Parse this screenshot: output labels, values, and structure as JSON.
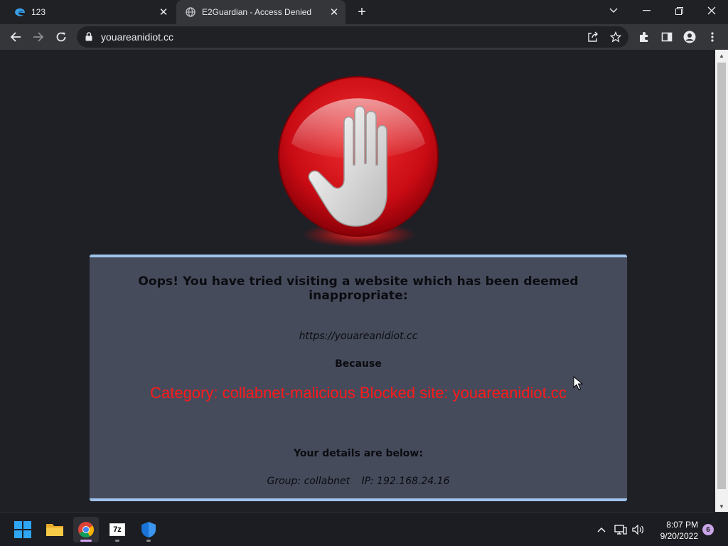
{
  "browser": {
    "tabs": [
      {
        "label": "123",
        "icon": "edge-logo-icon"
      },
      {
        "label": "E2Guardian - Access Denied",
        "icon": "globe-icon"
      }
    ],
    "address_bar": {
      "url": "youareanidiot.cc"
    }
  },
  "page": {
    "intro": "Oops! You have tried visiting a website which has been deemed inappropriate:",
    "blocked_url": "https://youareanidiot.cc",
    "because": "Because",
    "reason": "Category: collabnet-malicious  Blocked site: youareanidiot.cc",
    "details_heading": "Your details are below:",
    "group": "Group: collabnet",
    "ip": "IP: 192.168.24.16",
    "colors": {
      "reason": "#ff1a1a",
      "panel_bg": "#464b5c",
      "panel_border": "#9fc3ea",
      "stop_sign": "#d0101a"
    }
  },
  "taskbar": {
    "apps": [
      {
        "name": "start-button",
        "icon": "windows-logo-icon"
      },
      {
        "name": "file-explorer",
        "icon": "folder-icon"
      },
      {
        "name": "chrome",
        "icon": "chrome-icon",
        "active": true
      },
      {
        "name": "7-zip",
        "icon": "7zip-icon",
        "label": "7z"
      },
      {
        "name": "windows-security",
        "icon": "shield-icon"
      }
    ],
    "clock": {
      "time": "8:07 PM",
      "date": "9/20/2022"
    },
    "notifications": "6"
  }
}
